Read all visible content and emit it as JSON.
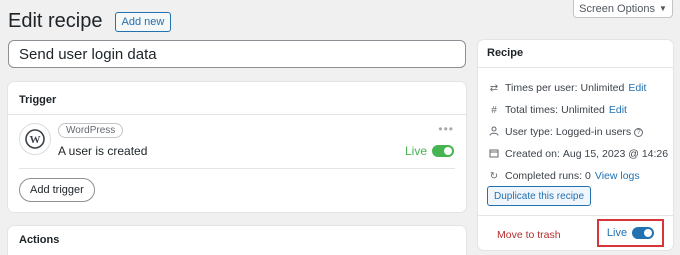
{
  "header": {
    "title": "Edit recipe",
    "add_new_label": "Add new"
  },
  "screen_options": {
    "label": "Screen Options",
    "caret": "▼"
  },
  "recipe_title": {
    "value": "Send user login data"
  },
  "trigger_panel": {
    "title": "Trigger",
    "integration_name": "WordPress",
    "trigger_text": "A user is created",
    "more_glyph": "•••",
    "status_label": "Live",
    "add_trigger_label": "Add trigger"
  },
  "actions_panel": {
    "title": "Actions"
  },
  "recipe_panel": {
    "title": "Recipe",
    "times_per_user": {
      "label": "Times per user:",
      "value": "Unlimited",
      "link": "Edit",
      "icon": "repeat-icon"
    },
    "total_times": {
      "label": "Total times:",
      "value": "Unlimited",
      "link": "Edit",
      "icon": "hash-icon"
    },
    "user_type": {
      "label": "User type:",
      "value": "Logged-in users",
      "icon": "user-icon"
    },
    "created_on": {
      "label": "Created on:",
      "value": "Aug 15, 2023 @ 14:26",
      "icon": "calendar-icon"
    },
    "completed_runs": {
      "label": "Completed runs:",
      "value": "0",
      "link": "View logs",
      "icon": "refresh-icon"
    },
    "duplicate_label": "Duplicate this recipe",
    "trash_label": "Move to trash",
    "status_label": "Live"
  },
  "colors": {
    "link": "#2271b1",
    "live_green": "#46b450",
    "trash_red": "#b32d2e",
    "highlight_red": "#d63638"
  }
}
